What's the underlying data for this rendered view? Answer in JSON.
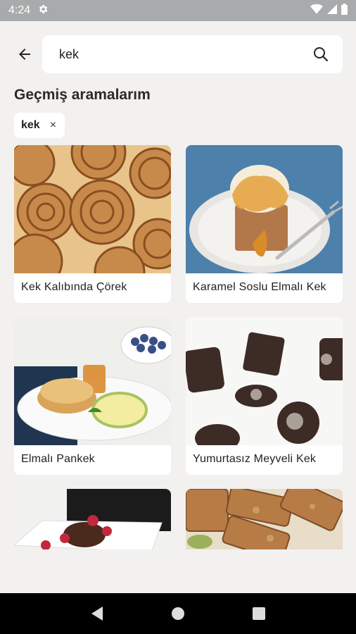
{
  "status_bar": {
    "time": "4:24",
    "icons": [
      "settings-gear-icon",
      "wifi-icon",
      "signal-icon",
      "battery-icon"
    ]
  },
  "search": {
    "value": "kek",
    "icons": {
      "back": "back-arrow-icon",
      "search": "search-icon"
    }
  },
  "history": {
    "title": "Geçmiş aramalarım",
    "chips": [
      {
        "label": "kek",
        "close": "×"
      }
    ]
  },
  "recipes": [
    {
      "title": "Kek Kalıbında Çörek"
    },
    {
      "title": "Karamel Soslu Elmalı Kek"
    },
    {
      "title": "Elmalı Pankek"
    },
    {
      "title": "Yumurtasız Meyveli Kek"
    },
    {
      "title": ""
    },
    {
      "title": ""
    }
  ],
  "nav": {
    "icons": [
      "back-triangle-icon",
      "home-circle-icon",
      "recents-square-icon"
    ]
  }
}
